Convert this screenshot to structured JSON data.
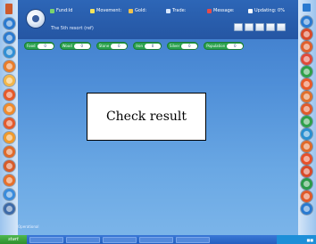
{
  "header": {
    "tagline": "The 5th resort (ref)",
    "stats": [
      {
        "label": "Fund:ld",
        "color": "#7bd36d"
      },
      {
        "label": "Movement:",
        "color": "#f5e45a"
      },
      {
        "label": "Gold:",
        "color": "#f0c24a"
      },
      {
        "label": "Trade:",
        "color": "#d8e7ff"
      },
      {
        "label": "Message:",
        "color": "#e64a4a"
      },
      {
        "label": "Updating: 0%",
        "color": "#ffffff"
      }
    ],
    "toolbar_icons": [
      "help-icon",
      "mail-icon",
      "settings-icon",
      "minimize-icon",
      "close-icon"
    ]
  },
  "tabs": [
    {
      "label": "Food",
      "value": "0"
    },
    {
      "label": "Wood",
      "value": "0"
    },
    {
      "label": "Stone",
      "value": "0"
    },
    {
      "label": "Iron",
      "value": "0"
    },
    {
      "label": "Silver",
      "value": "0"
    },
    {
      "label": "Population",
      "value": "0"
    }
  ],
  "dialog": {
    "text": "Check result"
  },
  "left_rail": [
    {
      "icon": "lighthouse-icon",
      "color": "#cc5b2e"
    },
    {
      "icon": "arrow-up-icon",
      "color": "#2a7ad0"
    },
    {
      "icon": "forward-icon",
      "color": "#2a7ad0"
    },
    {
      "icon": "globe-icon",
      "color": "#2f8fd5"
    },
    {
      "icon": "shield-icon",
      "color": "#e97d2b"
    },
    {
      "icon": "scroll-icon",
      "color": "#f2b64a"
    },
    {
      "icon": "sword-icon",
      "color": "#e65a2a"
    },
    {
      "icon": "coin-icon",
      "color": "#f08a2c"
    },
    {
      "icon": "flag-icon",
      "color": "#e45b2c"
    },
    {
      "icon": "star-icon",
      "color": "#f09a2c"
    },
    {
      "icon": "tower-icon",
      "color": "#e06a2a"
    },
    {
      "icon": "gem-icon",
      "color": "#d85c2a"
    },
    {
      "icon": "potion-icon",
      "color": "#3a8cdc"
    },
    {
      "icon": "map-icon",
      "color": "#2a6fbf"
    },
    {
      "icon": "hero-icon",
      "color": "#3d6aa8"
    }
  ],
  "right_rail": [
    {
      "icon": "book-icon",
      "color": "#2a7ad0"
    },
    {
      "icon": "chart-icon",
      "color": "#d84a2a"
    },
    {
      "icon": "mail-icon",
      "color": "#e0602c"
    },
    {
      "icon": "pen-icon",
      "color": "#e04a3a"
    },
    {
      "icon": "leaf-icon",
      "color": "#2fa04a"
    },
    {
      "icon": "bell-icon",
      "color": "#e95a2a"
    },
    {
      "icon": "key-icon",
      "color": "#e0702c"
    },
    {
      "icon": "crown-icon",
      "color": "#e05a2a"
    },
    {
      "icon": "anchor-icon",
      "color": "#2fa04a"
    },
    {
      "icon": "castle-icon",
      "color": "#2a8fd0"
    },
    {
      "icon": "helmet-icon",
      "color": "#e06a2a"
    },
    {
      "icon": "torch-icon",
      "color": "#e6502a"
    },
    {
      "icon": "ring-icon",
      "color": "#d84a2a"
    },
    {
      "icon": "shield-icon",
      "color": "#2a9a4a"
    },
    {
      "icon": "bow-icon",
      "color": "#e05a2a"
    },
    {
      "icon": "compass-icon",
      "color": "#2a7ad0"
    },
    {
      "icon": "scroll-icon",
      "color": "#e0602c"
    }
  ],
  "status": {
    "text": "Operational"
  },
  "taskbar": {
    "start": "start"
  }
}
